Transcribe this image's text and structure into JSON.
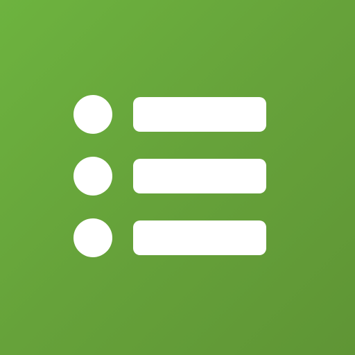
{
  "icon": {
    "name": "bulleted-list-icon",
    "background_colors": [
      "#6db33f",
      "#66a23a",
      "#5f9535"
    ],
    "foreground_color": "#ffffff",
    "rows": [
      {
        "name": "list-row-1"
      },
      {
        "name": "list-row-2"
      },
      {
        "name": "list-row-3"
      }
    ]
  }
}
